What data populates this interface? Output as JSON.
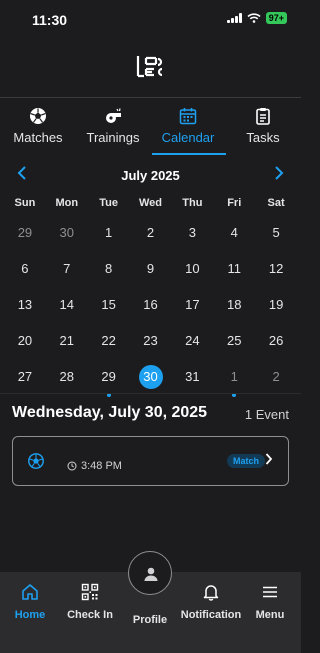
{
  "status_bar": {
    "time": "11:30",
    "battery": "97+"
  },
  "tabs": [
    {
      "label": "Matches",
      "icon": "soccer-ball-icon"
    },
    {
      "label": "Trainings",
      "icon": "whistle-icon"
    },
    {
      "label": "Calendar",
      "icon": "calendar-icon",
      "active": true
    },
    {
      "label": "Tasks",
      "icon": "clipboard-icon"
    }
  ],
  "calendar": {
    "month_title": "July 2025",
    "weekdays": [
      "Sun",
      "Mon",
      "Tue",
      "Wed",
      "Thu",
      "Fri",
      "Sat"
    ],
    "weeks": [
      [
        "29",
        "30",
        "1",
        "2",
        "3",
        "4",
        "5"
      ],
      [
        "6",
        "7",
        "8",
        "9",
        "10",
        "11",
        "12"
      ],
      [
        "13",
        "14",
        "15",
        "16",
        "17",
        "18",
        "19"
      ],
      [
        "20",
        "21",
        "22",
        "23",
        "24",
        "25",
        "26"
      ],
      [
        "27",
        "28",
        "29",
        "30",
        "31",
        "1",
        "2"
      ]
    ]
  },
  "selected_day": {
    "title": "Wednesday, July 30, 2025",
    "event_count": "1 Event"
  },
  "event": {
    "time": "3:48 PM",
    "tag": "Match"
  },
  "bottom_nav": [
    {
      "label": "Home",
      "icon": "home-icon",
      "active": true
    },
    {
      "label": "Check In",
      "icon": "qr-code-icon"
    },
    {
      "label": "Profile",
      "icon": "person-icon"
    },
    {
      "label": "Notification",
      "icon": "bell-icon"
    },
    {
      "label": "Menu",
      "icon": "hamburger-menu-icon"
    }
  ],
  "colors": {
    "accent": "#1ea0f0",
    "background": "#1c1c1e",
    "nav_background": "#2c2c2e"
  }
}
